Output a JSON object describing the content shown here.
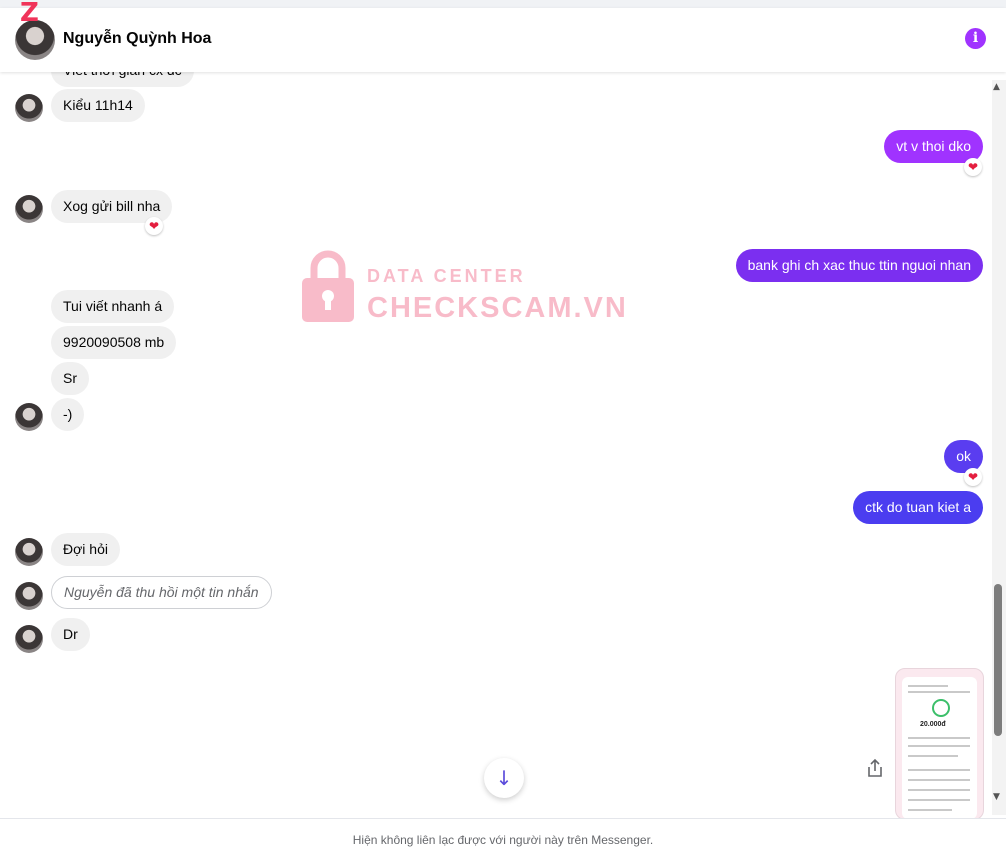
{
  "header": {
    "contact_name": "Nguyễn Quỳnh Hoa",
    "info_icon": "info-icon",
    "logo_mark": "Z"
  },
  "messages": {
    "m0": "Viết thời gian cx đc",
    "m1": "Kiểu 11h14",
    "m2": "vt v thoi dko",
    "m3": "Xog gửi bill nha",
    "m4": "bank ghi ch xac thuc ttin nguoi nhan",
    "m5": "Tui viết nhanh á",
    "m6": "9920090508 mb",
    "m7": "Sr",
    "m8": "-)",
    "m9": "ok",
    "m10": "ctk do tuan kiet a",
    "m11": "Đợi hỏi",
    "m12": "Nguyễn đã thu hồi một tin nhắn",
    "m13": "Dr"
  },
  "reactions": {
    "heart": "❤"
  },
  "watermark": {
    "line1": "DATA CENTER",
    "line2": "CHECKSCAM.VN"
  },
  "attachment": {
    "amount": "20.000đ"
  },
  "scroll_down_glyph": "↓",
  "footer": {
    "notice": "Hiện không liên lạc được với người này trên Messenger."
  },
  "colors": {
    "outgoing_purple": "#a033ff",
    "outgoing_violet": "#7b2ff0",
    "outgoing_indigo": "#4b3df0",
    "incoming_bg": "#f0f0f0",
    "reaction_heart": "#e41e3f"
  }
}
